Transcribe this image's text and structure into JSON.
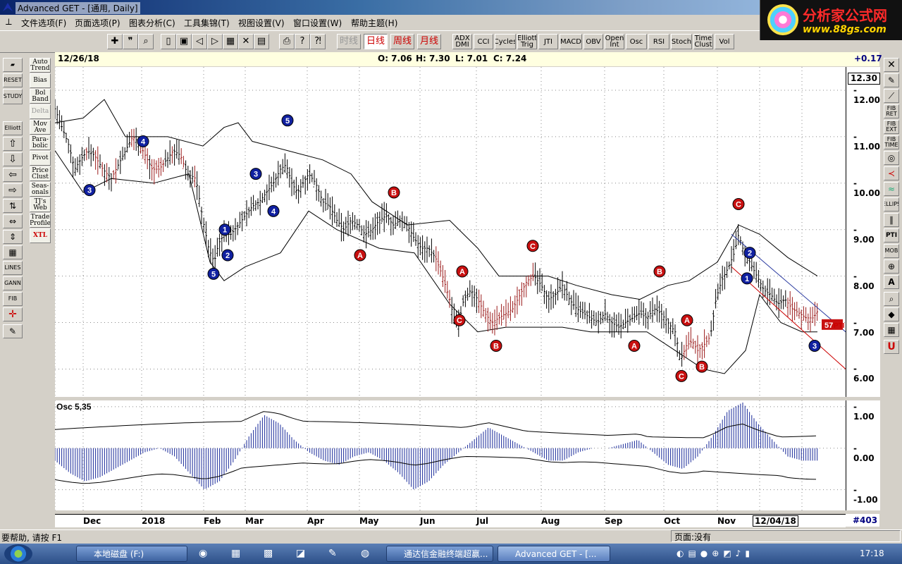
{
  "window": {
    "title": "Advanced GET - [通用, Daily]"
  },
  "logo": {
    "line1": "分析家公式网",
    "line2": "www.88gs.com"
  },
  "menu": [
    "文件选项(F)",
    "页面选项(P)",
    "图表分析(C)",
    "工具集锦(T)",
    "视图设置(V)",
    "窗口设置(W)",
    "帮助主题(H)"
  ],
  "toolbar": {
    "periods": [
      "时线",
      "日线",
      "周线",
      "月线"
    ],
    "indicators": [
      "ADX DMI",
      "CCI",
      "Cycles",
      "Elliott Trig",
      "JTI",
      "MACD",
      "OBV",
      "Open Int",
      "Osc",
      "RSI",
      "Stoch",
      "Time Clust",
      "Vol"
    ]
  },
  "left_tools": [
    "Auto Trend",
    "Bias",
    "Bol Band",
    "Delta",
    "Mov Ave",
    "Para- bolic",
    "Pivot",
    "Price Clust",
    "Seas- onals",
    "TJ's Web",
    "Trade Profile",
    "XTL"
  ],
  "left_icons": [
    "RESET",
    "STUDY",
    "Elliott",
    "LINES",
    "GANN",
    "FIB"
  ],
  "right_tools": [
    "FIB RET",
    "FIB EXT",
    "FIB TIME",
    "ELLIPS",
    "PTI",
    "MOB"
  ],
  "chart": {
    "date": "12/26/18",
    "ohlc": {
      "o": "O: 7.06",
      "h": "H: 7.30",
      "l": "L: 7.01",
      "c": "C: 7.24"
    },
    "change": "+0.17",
    "last_price": "12.30",
    "price_ticks": [
      "12.00",
      "11.00",
      "10.00",
      "9.00",
      "8.00",
      "7.00",
      "6.00"
    ],
    "osc_label": "Osc 5,35",
    "osc_ticks": [
      "1.00",
      "0.00",
      "-1.00"
    ],
    "months": [
      "Dec",
      "2018",
      "Feb",
      "Mar",
      "Apr",
      "May",
      "Jun",
      "Jul",
      "Aug",
      "Sep",
      "Oct",
      "Nov",
      "12/04/18"
    ],
    "bar_count": "#403",
    "pti_label": "57",
    "pti_text": "PTI"
  },
  "chart_data": {
    "type": "line",
    "title": "",
    "y_range": [
      5.4,
      12.5
    ],
    "close_path": [
      [
        0,
        11.6
      ],
      [
        10,
        11.2
      ],
      [
        20,
        10.8
      ],
      [
        28,
        10.3
      ],
      [
        36,
        10.5
      ],
      [
        46,
        10.7
      ],
      [
        56,
        10.6
      ],
      [
        68,
        10.3
      ],
      [
        80,
        10.1
      ],
      [
        90,
        10.4
      ],
      [
        100,
        10.7
      ],
      [
        110,
        11.0
      ],
      [
        118,
        10.9
      ],
      [
        128,
        10.6
      ],
      [
        138,
        10.3
      ],
      [
        148,
        10.3
      ],
      [
        158,
        10.5
      ],
      [
        168,
        10.7
      ],
      [
        178,
        10.6
      ],
      [
        188,
        10.2
      ],
      [
        200,
        10.1
      ],
      [
        210,
        9.2
      ],
      [
        218,
        8.6
      ],
      [
        226,
        8.3
      ],
      [
        232,
        8.7
      ],
      [
        240,
        8.9
      ],
      [
        250,
        8.9
      ],
      [
        260,
        9.1
      ],
      [
        270,
        9.3
      ],
      [
        280,
        9.5
      ],
      [
        290,
        9.6
      ],
      [
        300,
        9.8
      ],
      [
        310,
        10.0
      ],
      [
        320,
        10.3
      ],
      [
        328,
        10.4
      ],
      [
        336,
        10.0
      ],
      [
        344,
        9.8
      ],
      [
        352,
        10.0
      ],
      [
        360,
        10.2
      ],
      [
        370,
        10.0
      ],
      [
        380,
        9.6
      ],
      [
        390,
        9.5
      ],
      [
        400,
        9.2
      ],
      [
        410,
        9.0
      ],
      [
        420,
        9.2
      ],
      [
        430,
        9.1
      ],
      [
        440,
        8.9
      ],
      [
        450,
        9.0
      ],
      [
        460,
        9.2
      ],
      [
        470,
        9.3
      ],
      [
        480,
        9.1
      ],
      [
        490,
        9.2
      ],
      [
        500,
        9.1
      ],
      [
        510,
        8.8
      ],
      [
        520,
        8.6
      ],
      [
        530,
        8.6
      ],
      [
        540,
        8.4
      ],
      [
        550,
        8.0
      ],
      [
        560,
        7.5
      ],
      [
        566,
        7.1
      ],
      [
        572,
        6.9
      ],
      [
        580,
        7.5
      ],
      [
        590,
        7.7
      ],
      [
        600,
        7.5
      ],
      [
        610,
        7.2
      ],
      [
        620,
        7.0
      ],
      [
        630,
        7.1
      ],
      [
        640,
        7.2
      ],
      [
        650,
        7.3
      ],
      [
        660,
        7.6
      ],
      [
        670,
        7.9
      ],
      [
        680,
        8.0
      ],
      [
        690,
        7.8
      ],
      [
        700,
        7.5
      ],
      [
        710,
        7.6
      ],
      [
        720,
        7.8
      ],
      [
        730,
        7.5
      ],
      [
        740,
        7.3
      ],
      [
        750,
        7.2
      ],
      [
        760,
        7.1
      ],
      [
        770,
        7.0
      ],
      [
        780,
        7.2
      ],
      [
        790,
        7.0
      ],
      [
        800,
        6.9
      ],
      [
        810,
        7.0
      ],
      [
        820,
        7.1
      ],
      [
        830,
        7.2
      ],
      [
        840,
        7.1
      ],
      [
        850,
        7.3
      ],
      [
        860,
        7.2
      ],
      [
        870,
        7.0
      ],
      [
        880,
        6.8
      ],
      [
        888,
        6.2
      ],
      [
        896,
        6.5
      ],
      [
        904,
        6.6
      ],
      [
        912,
        6.4
      ],
      [
        920,
        6.5
      ],
      [
        930,
        6.7
      ],
      [
        938,
        7.5
      ],
      [
        946,
        7.9
      ],
      [
        956,
        8.2
      ],
      [
        964,
        8.5
      ],
      [
        970,
        8.9
      ],
      [
        978,
        8.5
      ],
      [
        986,
        8.3
      ],
      [
        996,
        8.0
      ],
      [
        1006,
        7.7
      ],
      [
        1016,
        7.6
      ],
      [
        1026,
        7.4
      ],
      [
        1036,
        7.5
      ],
      [
        1046,
        7.3
      ],
      [
        1056,
        7.2
      ],
      [
        1066,
        7.1
      ],
      [
        1076,
        7.1
      ],
      [
        1082,
        7.24
      ]
    ],
    "upper_band": [
      [
        0,
        11.3
      ],
      [
        40,
        11.4
      ],
      [
        70,
        11.8
      ],
      [
        100,
        11.0
      ],
      [
        160,
        11.0
      ],
      [
        210,
        10.8
      ],
      [
        240,
        11.2
      ],
      [
        260,
        11.3
      ],
      [
        280,
        10.9
      ],
      [
        330,
        10.7
      ],
      [
        380,
        10.5
      ],
      [
        420,
        10.2
      ],
      [
        450,
        9.6
      ],
      [
        500,
        9.1
      ],
      [
        560,
        9.2
      ],
      [
        600,
        8.6
      ],
      [
        630,
        8.0
      ],
      [
        660,
        8.0
      ],
      [
        700,
        8.0
      ],
      [
        740,
        7.8
      ],
      [
        790,
        7.6
      ],
      [
        830,
        7.5
      ],
      [
        870,
        7.8
      ],
      [
        900,
        7.9
      ],
      [
        940,
        8.3
      ],
      [
        970,
        9.1
      ],
      [
        1000,
        8.9
      ],
      [
        1040,
        8.4
      ],
      [
        1082,
        8.0
      ]
    ],
    "lower_band": [
      [
        0,
        10.7
      ],
      [
        40,
        9.8
      ],
      [
        80,
        10.1
      ],
      [
        140,
        10.0
      ],
      [
        190,
        10.2
      ],
      [
        220,
        8.3
      ],
      [
        240,
        7.9
      ],
      [
        270,
        8.2
      ],
      [
        320,
        8.5
      ],
      [
        360,
        9.4
      ],
      [
        400,
        9.0
      ],
      [
        460,
        8.6
      ],
      [
        510,
        8.5
      ],
      [
        560,
        7.4
      ],
      [
        600,
        6.8
      ],
      [
        640,
        6.9
      ],
      [
        680,
        6.9
      ],
      [
        720,
        6.9
      ],
      [
        760,
        6.8
      ],
      [
        800,
        6.8
      ],
      [
        840,
        6.8
      ],
      [
        880,
        6.4
      ],
      [
        920,
        6.0
      ],
      [
        950,
        5.9
      ],
      [
        980,
        6.4
      ],
      [
        1000,
        7.6
      ],
      [
        1030,
        7.0
      ],
      [
        1060,
        6.8
      ],
      [
        1082,
        6.8
      ]
    ],
    "osc_values": [
      -0.3,
      -0.6,
      -0.8,
      -0.7,
      -0.5,
      -0.3,
      -0.1,
      0.0,
      -0.2,
      -0.6,
      -1.0,
      -0.8,
      -0.3,
      0.3,
      0.8,
      0.6,
      0.2,
      -0.1,
      -0.3,
      -0.4,
      -0.2,
      -0.1,
      -0.3,
      -0.6,
      -1.0,
      -0.8,
      -0.4,
      -0.1,
      0.2,
      0.5,
      0.3,
      0.1,
      -0.1,
      -0.3,
      -0.3,
      -0.1,
      0.0,
      0.0,
      0.1,
      0.2,
      -0.1,
      -0.4,
      -0.5,
      -0.2,
      0.3,
      0.9,
      1.1,
      0.6,
      0.2,
      -0.2,
      -0.3,
      -0.3
    ],
    "osc_range": [
      -1.5,
      1.15
    ],
    "months": [
      "Dec",
      "2018",
      "Feb",
      "Mar",
      "Apr",
      "May",
      "Jun",
      "Jul",
      "Aug",
      "Sep",
      "Oct",
      "Nov",
      "12/04/18"
    ]
  },
  "waves": [
    {
      "label": "3",
      "kind": "blue",
      "x": 49,
      "p": 9.85
    },
    {
      "label": "4",
      "kind": "blue",
      "x": 125,
      "p": 10.9
    },
    {
      "label": "5",
      "kind": "blue",
      "x": 225,
      "p": 8.05
    },
    {
      "label": "1",
      "kind": "blue",
      "x": 241,
      "p": 9.0
    },
    {
      "label": "2",
      "kind": "blue",
      "x": 245,
      "p": 8.45
    },
    {
      "label": "3",
      "kind": "blue",
      "x": 285,
      "p": 10.2
    },
    {
      "label": "4",
      "kind": "blue",
      "x": 310,
      "p": 9.4
    },
    {
      "label": "5",
      "kind": "blue",
      "x": 330,
      "p": 11.35
    },
    {
      "label": "A",
      "kind": "red",
      "x": 433,
      "p": 8.45
    },
    {
      "label": "B",
      "kind": "red",
      "x": 481,
      "p": 9.8
    },
    {
      "label": "C",
      "kind": "red",
      "x": 574,
      "p": 7.05
    },
    {
      "label": "A",
      "kind": "red",
      "x": 578,
      "p": 8.1
    },
    {
      "label": "B",
      "kind": "red",
      "x": 626,
      "p": 6.5
    },
    {
      "label": "C",
      "kind": "red",
      "x": 678,
      "p": 8.65
    },
    {
      "label": "A",
      "kind": "red",
      "x": 822,
      "p": 6.5
    },
    {
      "label": "B",
      "kind": "red",
      "x": 858,
      "p": 8.1
    },
    {
      "label": "A",
      "kind": "red",
      "x": 897,
      "p": 7.05
    },
    {
      "label": "C",
      "kind": "red",
      "x": 889,
      "p": 5.85
    },
    {
      "label": "B",
      "kind": "red",
      "x": 918,
      "p": 6.05
    },
    {
      "label": "C",
      "kind": "red",
      "x": 970,
      "p": 9.55
    },
    {
      "label": "2",
      "kind": "blue",
      "x": 986,
      "p": 8.5
    },
    {
      "label": "1",
      "kind": "blue",
      "x": 982,
      "p": 7.95
    },
    {
      "label": "3",
      "kind": "blue",
      "x": 1078,
      "p": 6.5
    }
  ],
  "status": {
    "help": "要帮助, 请按 F1",
    "page": "页面:没有"
  },
  "taskbar": {
    "items": [
      "本地磁盘 (F:)",
      "通达信金融终端超赢...",
      "Advanced GET - [..."
    ],
    "clock": "17:18"
  }
}
